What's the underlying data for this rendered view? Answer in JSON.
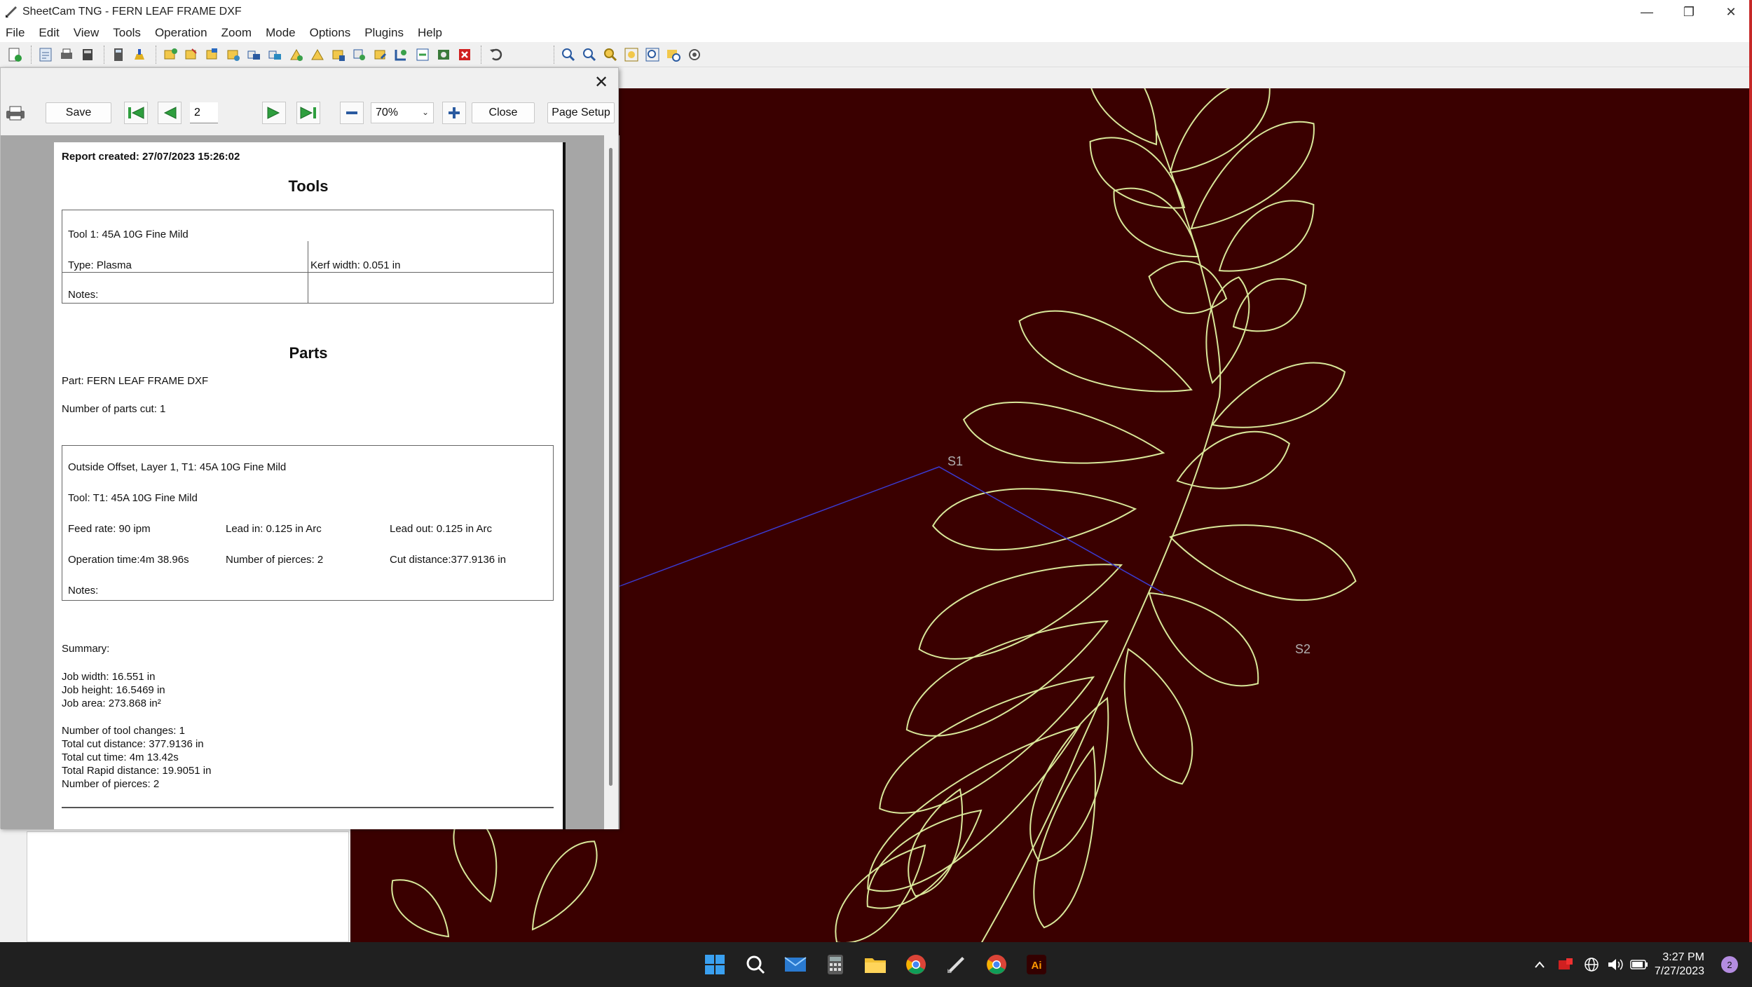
{
  "window": {
    "title": "SheetCam TNG - FERN LEAF FRAME DXF"
  },
  "menu": [
    "File",
    "Edit",
    "View",
    "Tools",
    "Operation",
    "Zoom",
    "Mode",
    "Options",
    "Plugins",
    "Help"
  ],
  "report_toolbar": {
    "save_label": "Save",
    "page_value": "2",
    "zoom_value": "70%",
    "close_label": "Close",
    "page_setup_label": "Page Setup"
  },
  "report": {
    "created": "Report created: 27/07/2023 15:26:02",
    "tools_heading": "Tools",
    "tool": {
      "name": "Tool 1: 45A 10G Fine Mild",
      "type": "Type: Plasma",
      "kerf": "Kerf width: 0.051 in",
      "notes": "Notes:"
    },
    "parts_heading": "Parts",
    "part": "Part: FERN LEAF FRAME DXF",
    "parts_cut": "Number of parts cut: 1",
    "operation": {
      "title": "Outside Offset, Layer 1, T1: 45A 10G Fine Mild",
      "tool": "Tool: T1: 45A 10G Fine Mild",
      "feed_rate": "Feed rate: 90 ipm",
      "lead_in": "Lead in: 0.125 in Arc",
      "lead_out": "Lead out: 0.125 in Arc",
      "op_time": "Operation time:4m 38.96s",
      "pierces": "Number of pierces: 2",
      "cut_distance": "Cut distance:377.9136 in",
      "notes": "Notes:"
    },
    "summary": {
      "heading": "Summary:",
      "job_width": "Job width: 16.551 in",
      "job_height": "Job height: 16.5469 in",
      "job_area": "Job area: 273.868 in²",
      "tool_changes": "Number of tool changes: 1",
      "total_cut_distance": "Total cut distance: 377.9136 in",
      "total_cut_time": "Total cut time: 4m 13.42s",
      "total_rapid": "Total Rapid distance: 19.9051 in",
      "total_pierces": "Number of pierces: 2"
    }
  },
  "canvas": {
    "start_label_1": "S1",
    "start_label_2": "S2",
    "background": "#3a0000",
    "path_color": "#d9e89a",
    "rapid_color": "#3a3ad0"
  },
  "taskbar": {
    "time": "3:27 PM",
    "date": "7/27/2023",
    "notification_count": "2"
  }
}
